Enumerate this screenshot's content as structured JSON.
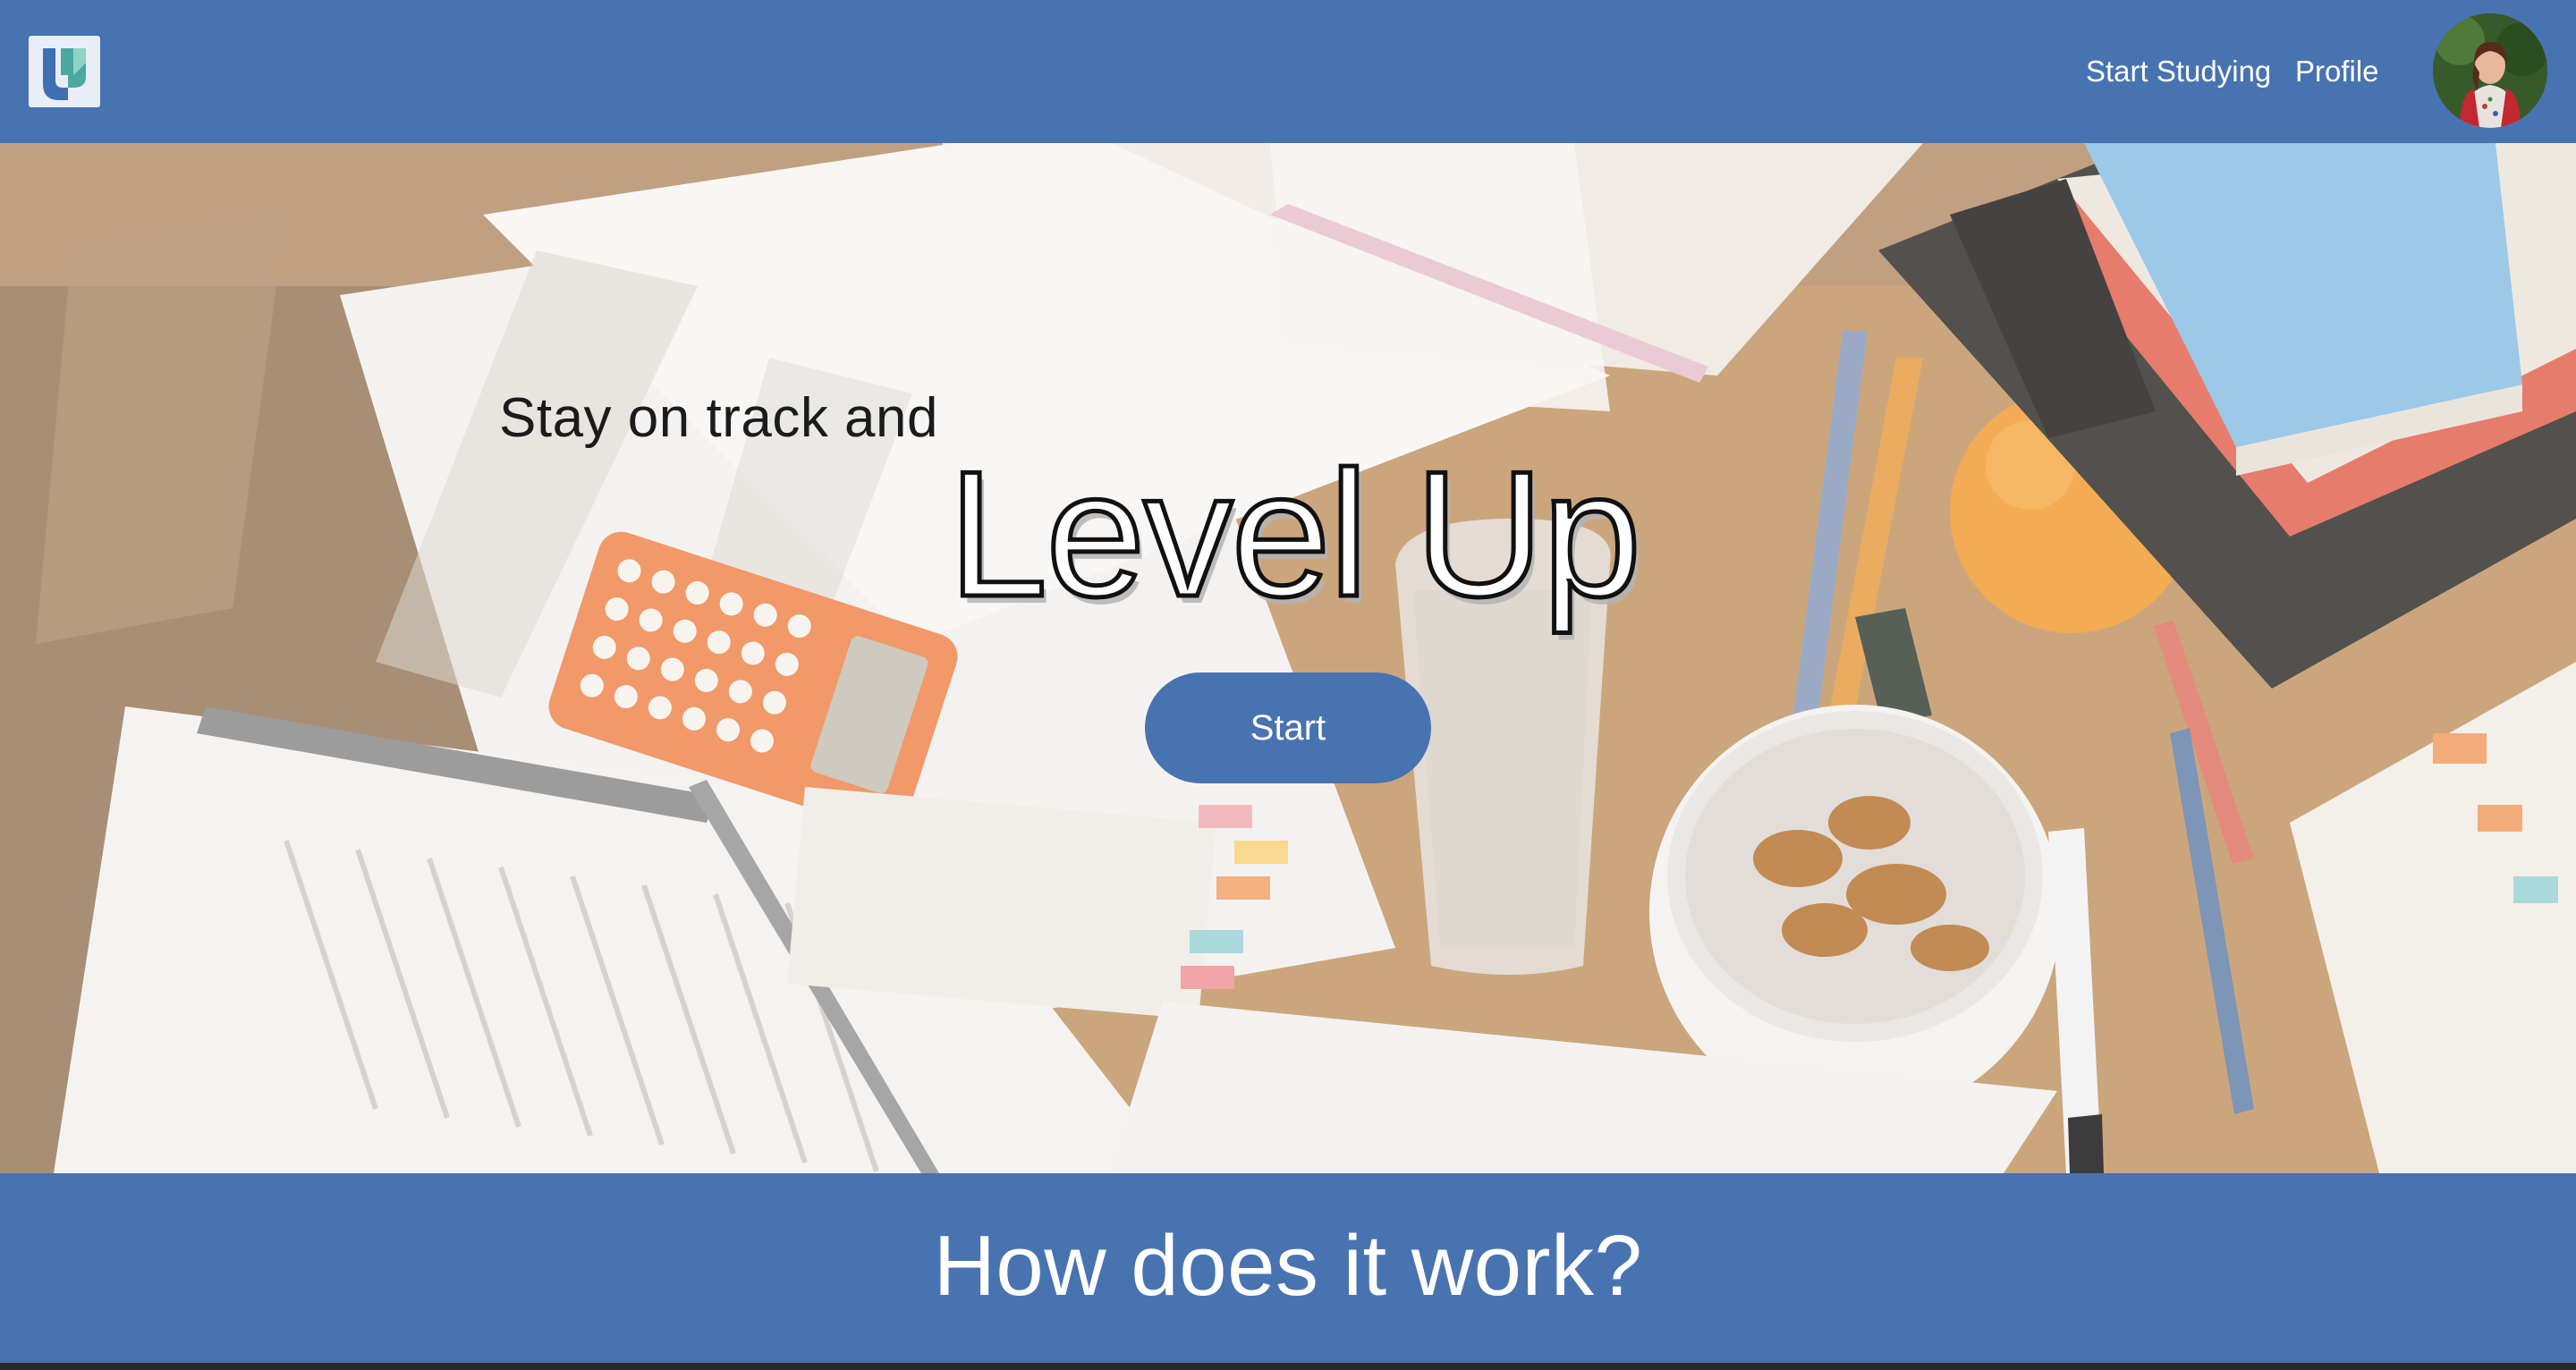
{
  "nav": {
    "logo_icon": "level-up-logo-icon",
    "links": [
      {
        "label": "Start Studying"
      },
      {
        "label": "Profile"
      }
    ],
    "avatar_icon": "user-avatar-icon"
  },
  "hero": {
    "tagline": "Stay on track and",
    "headline": "Level Up",
    "cta_label": "Start",
    "background_icon": "study-desk-photo"
  },
  "how": {
    "title": "How does it work?"
  },
  "colors": {
    "brand_blue": "#4873b1",
    "white": "#ffffff"
  }
}
